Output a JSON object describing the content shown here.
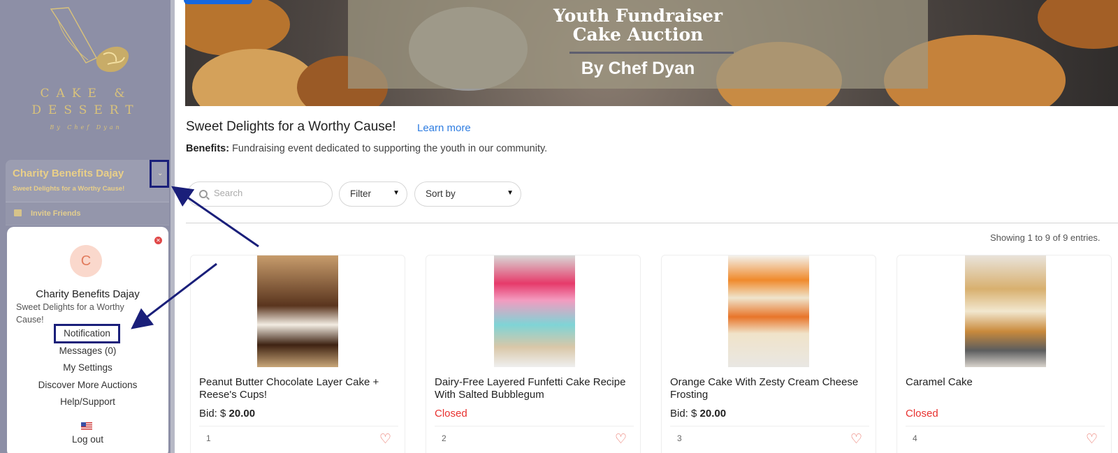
{
  "sidebar": {
    "logo_line1": "CAKE &",
    "logo_line2": "DESSERT",
    "logo_sub": "By Chef Dyan",
    "charity_name": "Charity Benefits Dajay",
    "charity_tagline": "Sweet Delights for a Worthy Cause!",
    "invite_label": "Invite Friends",
    "menu": {
      "avatar_letter": "C",
      "name": "Charity Benefits Dajay",
      "tagline": "Sweet Delights for a Worthy Cause!",
      "items": [
        "Notification",
        "Messages (0)",
        "My Settings",
        "Discover More Auctions",
        "Help/Support",
        "Log out"
      ]
    }
  },
  "hero": {
    "line1": "Youth Fundraiser",
    "line2": "Cake Auction",
    "line3": "By Chef Dyan"
  },
  "intro": {
    "title": "Sweet Delights for a Worthy Cause!",
    "learn_more": "Learn more",
    "benefits_label": "Benefits:",
    "benefits_text": "Fundraising event dedicated to supporting the youth in our community."
  },
  "toolbar": {
    "search_placeholder": "Search",
    "filter_label": "Filter",
    "sort_label": "Sort by"
  },
  "showing": "Showing 1 to 9 of 9 entries.",
  "bid_label": "Bid:",
  "currency": "$",
  "cards": [
    {
      "title": "Peanut Butter Chocolate Layer Cake + Reese's Cups!",
      "status": "bid",
      "bid": "20.00",
      "closed_label": "",
      "number": "1"
    },
    {
      "title": "Dairy-Free Layered Funfetti Cake Recipe With Salted Bubblegum",
      "status": "closed",
      "bid": "",
      "closed_label": "Closed",
      "number": "2"
    },
    {
      "title": "Orange Cake With Zesty Cream Cheese Frosting",
      "status": "bid",
      "bid": "20.00",
      "closed_label": "",
      "number": "3"
    },
    {
      "title": "Caramel Cake",
      "status": "closed",
      "bid": "",
      "closed_label": "Closed",
      "number": "4"
    }
  ],
  "colors": {
    "sidebar": "#8d8fa6",
    "gold": "#e9cf88",
    "annotation": "#1a1f7a",
    "link": "#2f7de1",
    "closed": "#e8312f"
  }
}
